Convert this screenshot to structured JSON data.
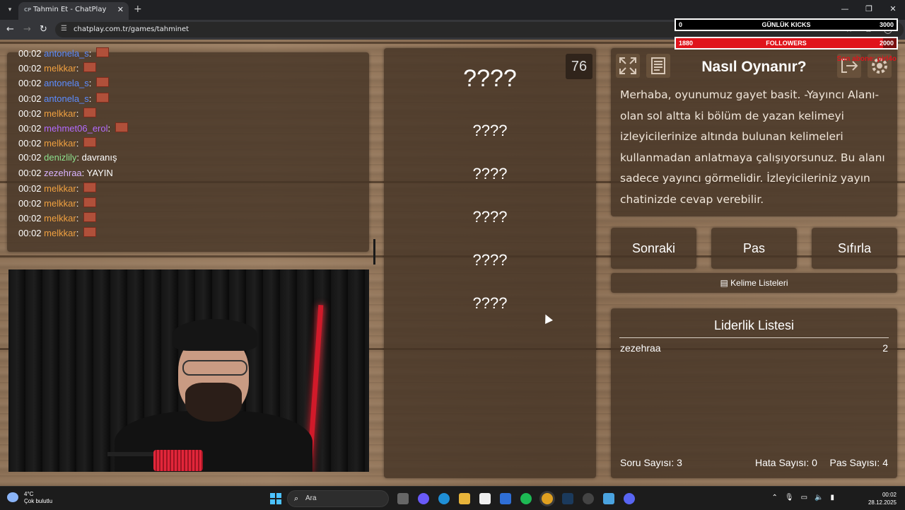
{
  "browser": {
    "tab_title": "Tahmin Et - ChatPlay",
    "tab_favicon": "CP",
    "url": "chatplay.com.tr/games/tahminet"
  },
  "overlay": {
    "kicks_label": "GÜNLÜK KICKS",
    "kicks_current": "0",
    "kicks_goal": "3000",
    "kicks_progress": 0.0,
    "followers_label": "FOLLOWERS",
    "followers_current": "1880",
    "followers_goal": "2000",
    "followers_progress": 0.94,
    "sub_text": "Son abone: pirl4o"
  },
  "chat": {
    "messages": [
      {
        "time": "00:02",
        "user": "antonela_s",
        "text": "",
        "color": "#5b8cff",
        "emote": true
      },
      {
        "time": "00:02",
        "user": "melkkar",
        "text": "",
        "color": "#f0a040",
        "emote": true
      },
      {
        "time": "00:02",
        "user": "antonela_s",
        "text": "",
        "color": "#5b8cff",
        "emote": true
      },
      {
        "time": "00:02",
        "user": "antonela_s",
        "text": "",
        "color": "#5b8cff",
        "emote": true
      },
      {
        "time": "00:02",
        "user": "melkkar",
        "text": "",
        "color": "#f0a040",
        "emote": true
      },
      {
        "time": "00:02",
        "user": "mehmet06_erol",
        "text": "",
        "color": "#b46bff",
        "emote": true
      },
      {
        "time": "00:02",
        "user": "melkkar",
        "text": "",
        "color": "#f0a040",
        "emote": true
      },
      {
        "time": "00:02",
        "user": "denizlily",
        "text": "davranış",
        "color": "#8de08d",
        "emote": false
      },
      {
        "time": "00:02",
        "user": "zezehraa",
        "text": "YAYIN",
        "color": "#d9b3ff",
        "emote": false
      },
      {
        "time": "00:02",
        "user": "melkkar",
        "text": "",
        "color": "#f0a040",
        "emote": true
      },
      {
        "time": "00:02",
        "user": "melkkar",
        "text": "",
        "color": "#f0a040",
        "emote": true
      },
      {
        "time": "00:02",
        "user": "melkkar",
        "text": "",
        "color": "#f0a040",
        "emote": true
      },
      {
        "time": "00:02",
        "user": "melkkar",
        "text": "",
        "color": "#f0a040",
        "emote": true
      }
    ]
  },
  "game": {
    "timer": "76",
    "words": [
      "????",
      "????",
      "????",
      "????",
      "????",
      "????"
    ]
  },
  "howto": {
    "title": "Nasıl Oynanır?",
    "text": "Merhaba, oyunumuz gayet basit. -Yayıncı Alanı- olan sol altta ki bölüm de yazan kelimeyi izleyicilerinize altında bulunan kelimeleri kullanmadan anlatmaya çalışıyorsunuz. Bu alanı sadece yayıncı görmelidir. İzleyicileriniz yayın chatinizde cevap verebilir."
  },
  "actions": {
    "next": "Sonraki",
    "pass": "Pas",
    "reset": "Sıfırla",
    "word_lists": "Kelime Listeleri"
  },
  "leaderboard": {
    "title": "Liderlik Listesi",
    "rows": [
      {
        "name": "zezehraa",
        "score": "2"
      }
    ],
    "question_count": "Soru Sayısı: 3",
    "error_count": "Hata Sayısı: 0",
    "pass_count": "Pas Sayısı: 4"
  },
  "taskbar": {
    "weather_temp": "4°C",
    "weather_desc": "Çok bulutlu",
    "search_placeholder": "Ara",
    "time": "00:02",
    "date": "28.12.2025"
  }
}
